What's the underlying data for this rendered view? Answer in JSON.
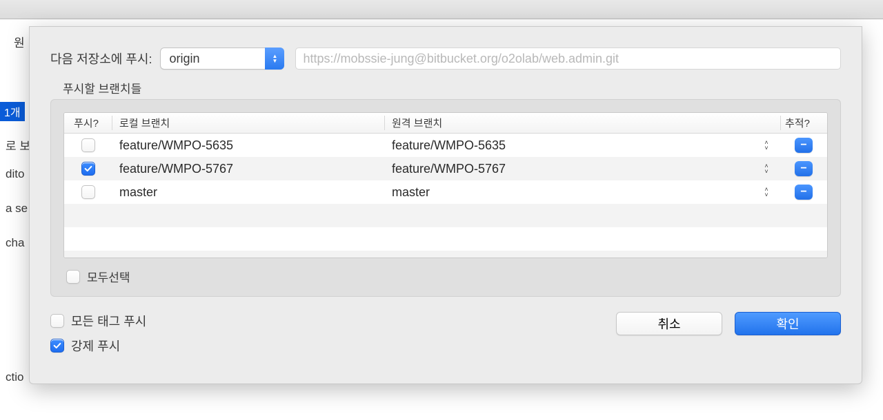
{
  "background": {
    "row1": "원",
    "badge": "1개",
    "row2": "로 보",
    "row3": "dito",
    "row4": "a se",
    "row5": "cha",
    "row6": "ctio"
  },
  "dialog": {
    "push_label": "다음 저장소에 푸시:",
    "remote_select": "origin",
    "url": "https://mobssie-jung@bitbucket.org/o2olab/web.admin.git",
    "branches_label": "푸시할 브랜치들",
    "headers": {
      "push": "푸시?",
      "local": "로컬 브랜치",
      "remote": "원격 브랜치",
      "track": "추적?"
    },
    "rows": [
      {
        "push": false,
        "local": "feature/WMPO-5635",
        "remote": "feature/WMPO-5635"
      },
      {
        "push": true,
        "local": "feature/WMPO-5767",
        "remote": "feature/WMPO-5767"
      },
      {
        "push": false,
        "local": "master",
        "remote": "master"
      }
    ],
    "select_all": "모두선택",
    "push_all_tags": "모든 태그 푸시",
    "force_push": "강제 푸시",
    "tags_checked": false,
    "force_checked": true,
    "cancel": "취소",
    "ok": "확인"
  }
}
